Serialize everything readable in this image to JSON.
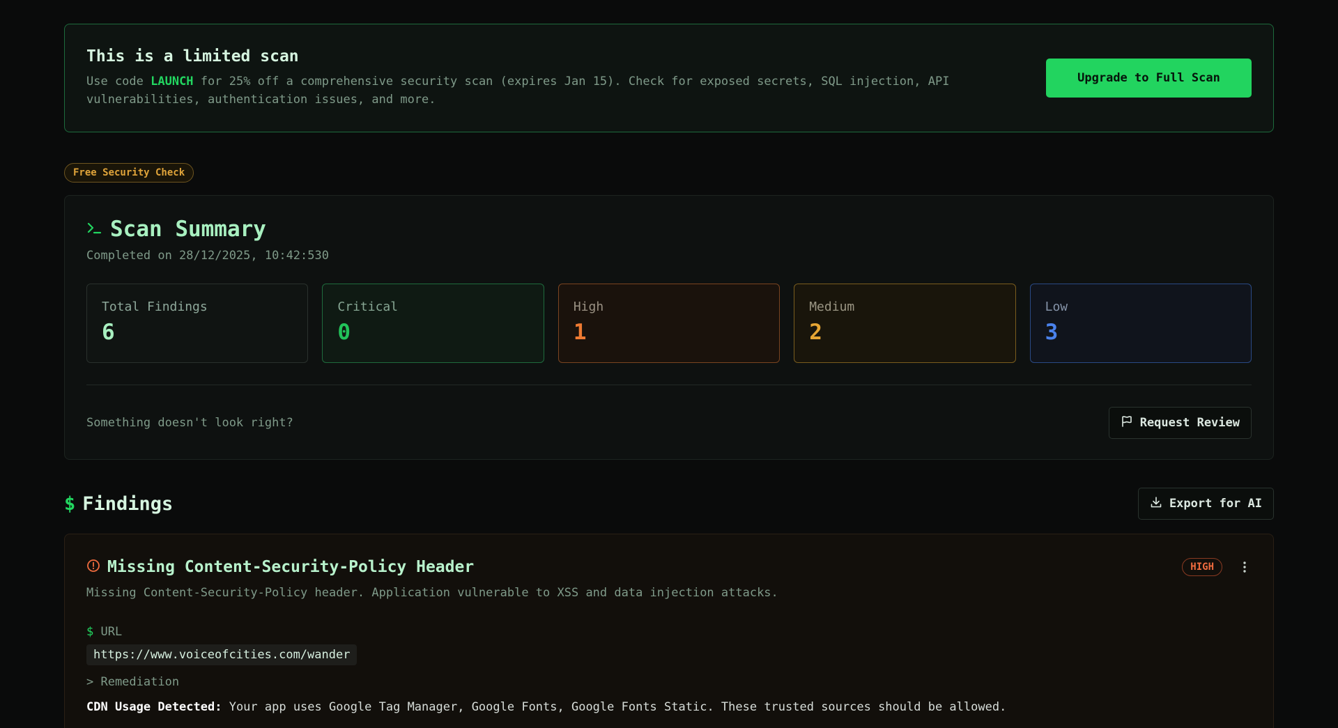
{
  "promo": {
    "title": "This is a limited scan",
    "desc_before": "Use code ",
    "code": "LAUNCH",
    "desc_after": " for 25% off a comprehensive security scan (expires Jan 15). Check for exposed secrets, SQL injection, API vulnerabilities, authentication issues, and more.",
    "button_label": "Upgrade to Full Scan"
  },
  "badge": "Free Security Check",
  "summary": {
    "title": "Scan Summary",
    "completed": "Completed on 28/12/2025, 10:42:530",
    "stats": [
      {
        "label": "Total Findings",
        "value": "6"
      },
      {
        "label": "Critical",
        "value": "0"
      },
      {
        "label": "High",
        "value": "1"
      },
      {
        "label": "Medium",
        "value": "2"
      },
      {
        "label": "Low",
        "value": "3"
      }
    ],
    "review_question": "Something doesn't look right?",
    "review_button": "Request Review"
  },
  "findings": {
    "title": "Findings",
    "dollar": "$",
    "export_button": "Export for AI",
    "items": [
      {
        "title": "Missing Content-Security-Policy Header",
        "severity": "HIGH",
        "description": "Missing Content-Security-Policy header. Application vulnerable to XSS and data injection attacks.",
        "url_label": " URL",
        "url": "https://www.voiceofcities.com/wander",
        "remediation_label": "> Remediation",
        "remediation_bold": "CDN Usage Detected:",
        "remediation_text": " Your app uses Google Tag Manager, Google Fonts, Google Fonts Static. These trusted sources should be allowed."
      }
    ]
  },
  "colors": {
    "accent": "#22d45f",
    "high": "#ee7a32",
    "medium": "#e6a533",
    "low": "#4a82ec",
    "critical": "#22c35a"
  },
  "icons": {
    "summary": "terminal-prompt-icon",
    "review": "flag-icon",
    "export": "download-icon",
    "finding": "alert-circle-icon",
    "menu": "kebab-menu-icon"
  }
}
